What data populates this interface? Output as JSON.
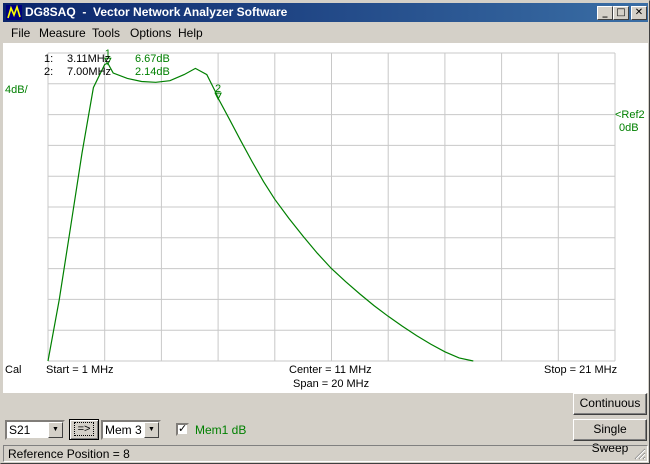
{
  "window": {
    "title": "DG8SAQ  -  Vector Network Analyzer Software",
    "minimize_glyph": "_",
    "maximize_glyph": "□",
    "close_glyph": "✕"
  },
  "menu": [
    "File",
    "Measure",
    "Tools",
    "Options",
    "Help"
  ],
  "plot": {
    "scale_label": "4dB/",
    "ref_label": "<Ref2",
    "ref_value": "0dB",
    "cal_label": "Cal",
    "start_label": "Start = 1 MHz",
    "center_label": "Center = 11 MHz",
    "span_label": "Span = 20 MHz",
    "stop_label": "Stop = 21 MHz",
    "markers": [
      {
        "id": "1",
        "num_label": "1:",
        "freq": "3.11MHz",
        "value": "6.67dB"
      },
      {
        "id": "2",
        "num_label": "2:",
        "freq": "7.00MHz",
        "value": "2.14dB"
      }
    ],
    "trace_color": "#008000",
    "grid_color": "#c8c8c8"
  },
  "chart_data": {
    "type": "line",
    "xlabel": "",
    "ylabel": "",
    "xlim": [
      1,
      21
    ],
    "ylim": [
      -32,
      8
    ],
    "grid": true,
    "series": [
      {
        "x": [
          1.0,
          1.4,
          1.8,
          2.2,
          2.6,
          3.0,
          3.11,
          3.3,
          3.8,
          4.3,
          4.8,
          5.3,
          5.8,
          6.2,
          6.6,
          6.9,
          7.0,
          7.4,
          7.8,
          8.2,
          8.6,
          9.0,
          9.5,
          10.0,
          10.5,
          11.0,
          11.5,
          12.0,
          12.5,
          13.0,
          13.5,
          14.0,
          14.5,
          15.0,
          15.5,
          16.0
        ],
        "y": [
          -32.0,
          -24.0,
          -14.5,
          -5.0,
          3.5,
          6.5,
          6.67,
          5.4,
          4.7,
          4.3,
          4.2,
          4.4,
          5.2,
          6.0,
          5.2,
          3.0,
          2.14,
          -0.6,
          -3.4,
          -6.1,
          -8.7,
          -11.0,
          -13.5,
          -15.8,
          -18.0,
          -20.0,
          -21.7,
          -23.3,
          -24.8,
          -26.2,
          -27.5,
          -28.7,
          -29.8,
          -30.8,
          -31.6,
          -32.0
        ]
      }
    ]
  },
  "controls": {
    "param_select": "S21",
    "copy_button": "=>",
    "mem_select": "Mem 3",
    "mem_checkbox_label": "Mem1  dB",
    "mem_checked": true,
    "continuous_button": "Continuous",
    "single_sweep_button": "Single Sweep"
  },
  "status": {
    "text": "Reference Position = 8"
  }
}
